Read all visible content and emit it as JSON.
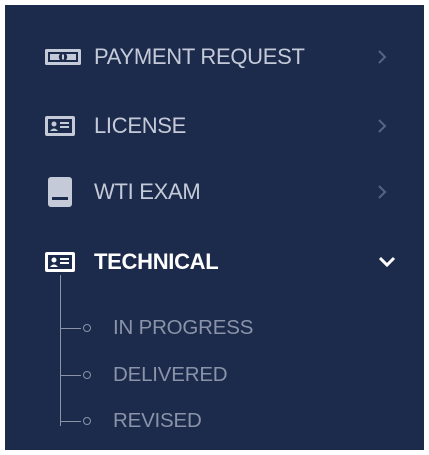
{
  "menu": {
    "items": [
      {
        "label": "PAYMENT REQUEST",
        "icon": "money-bill-icon",
        "expander": "chevron-right-icon"
      },
      {
        "label": "LICENSE",
        "icon": "id-card-icon",
        "expander": "chevron-right-icon"
      },
      {
        "label": "WTI EXAM",
        "icon": "book-icon",
        "expander": "chevron-right-icon"
      },
      {
        "label": "TECHNICAL",
        "icon": "id-card-icon",
        "expander": "chevron-down-icon",
        "active": true,
        "children": [
          {
            "label": "IN PROGRESS",
            "icon": "circle-bullet-icon"
          },
          {
            "label": "DELIVERED",
            "icon": "circle-bullet-icon"
          },
          {
            "label": "REVISED",
            "icon": "circle-bullet-icon"
          }
        ]
      }
    ]
  },
  "colors": {
    "sidebar_background": "#1c2a4b",
    "active_text": "#ffffff",
    "item_text": "#c4cad8",
    "submenu_text": "#8a93a8",
    "chevron_inactive": "#5a6584"
  }
}
